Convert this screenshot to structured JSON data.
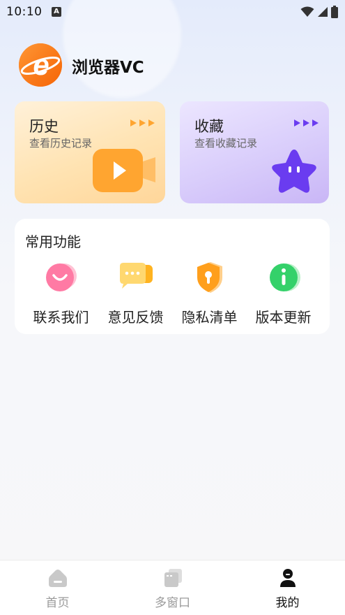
{
  "status_bar": {
    "time": "10:10",
    "notification_badge": "A"
  },
  "header": {
    "app_title": "浏览器VC",
    "logo_letter": "e"
  },
  "cards": {
    "history": {
      "title": "历史",
      "subtitle": "查看历史记录",
      "icon": "video-play-icon"
    },
    "favorites": {
      "title": "收藏",
      "subtitle": "查看收藏记录",
      "icon": "star-icon"
    }
  },
  "functions": {
    "title": "常用功能",
    "items": [
      {
        "label": "联系我们",
        "icon": "smile-chat-icon"
      },
      {
        "label": "意见反馈",
        "icon": "feedback-icon"
      },
      {
        "label": "隐私清单",
        "icon": "shield-lock-icon"
      },
      {
        "label": "版本更新",
        "icon": "info-icon"
      }
    ]
  },
  "bottom_nav": {
    "items": [
      {
        "label": "首页",
        "icon": "home-icon",
        "active": false
      },
      {
        "label": "多窗口",
        "icon": "windows-icon",
        "active": false
      },
      {
        "label": "我的",
        "icon": "profile-icon",
        "active": true
      }
    ]
  },
  "colors": {
    "history_accent": "#ffa530",
    "favorites_accent": "#6a3cf0",
    "logo_orange": "#ff7a12",
    "active_nav": "#111111",
    "inactive_nav": "#9a9a9a"
  }
}
